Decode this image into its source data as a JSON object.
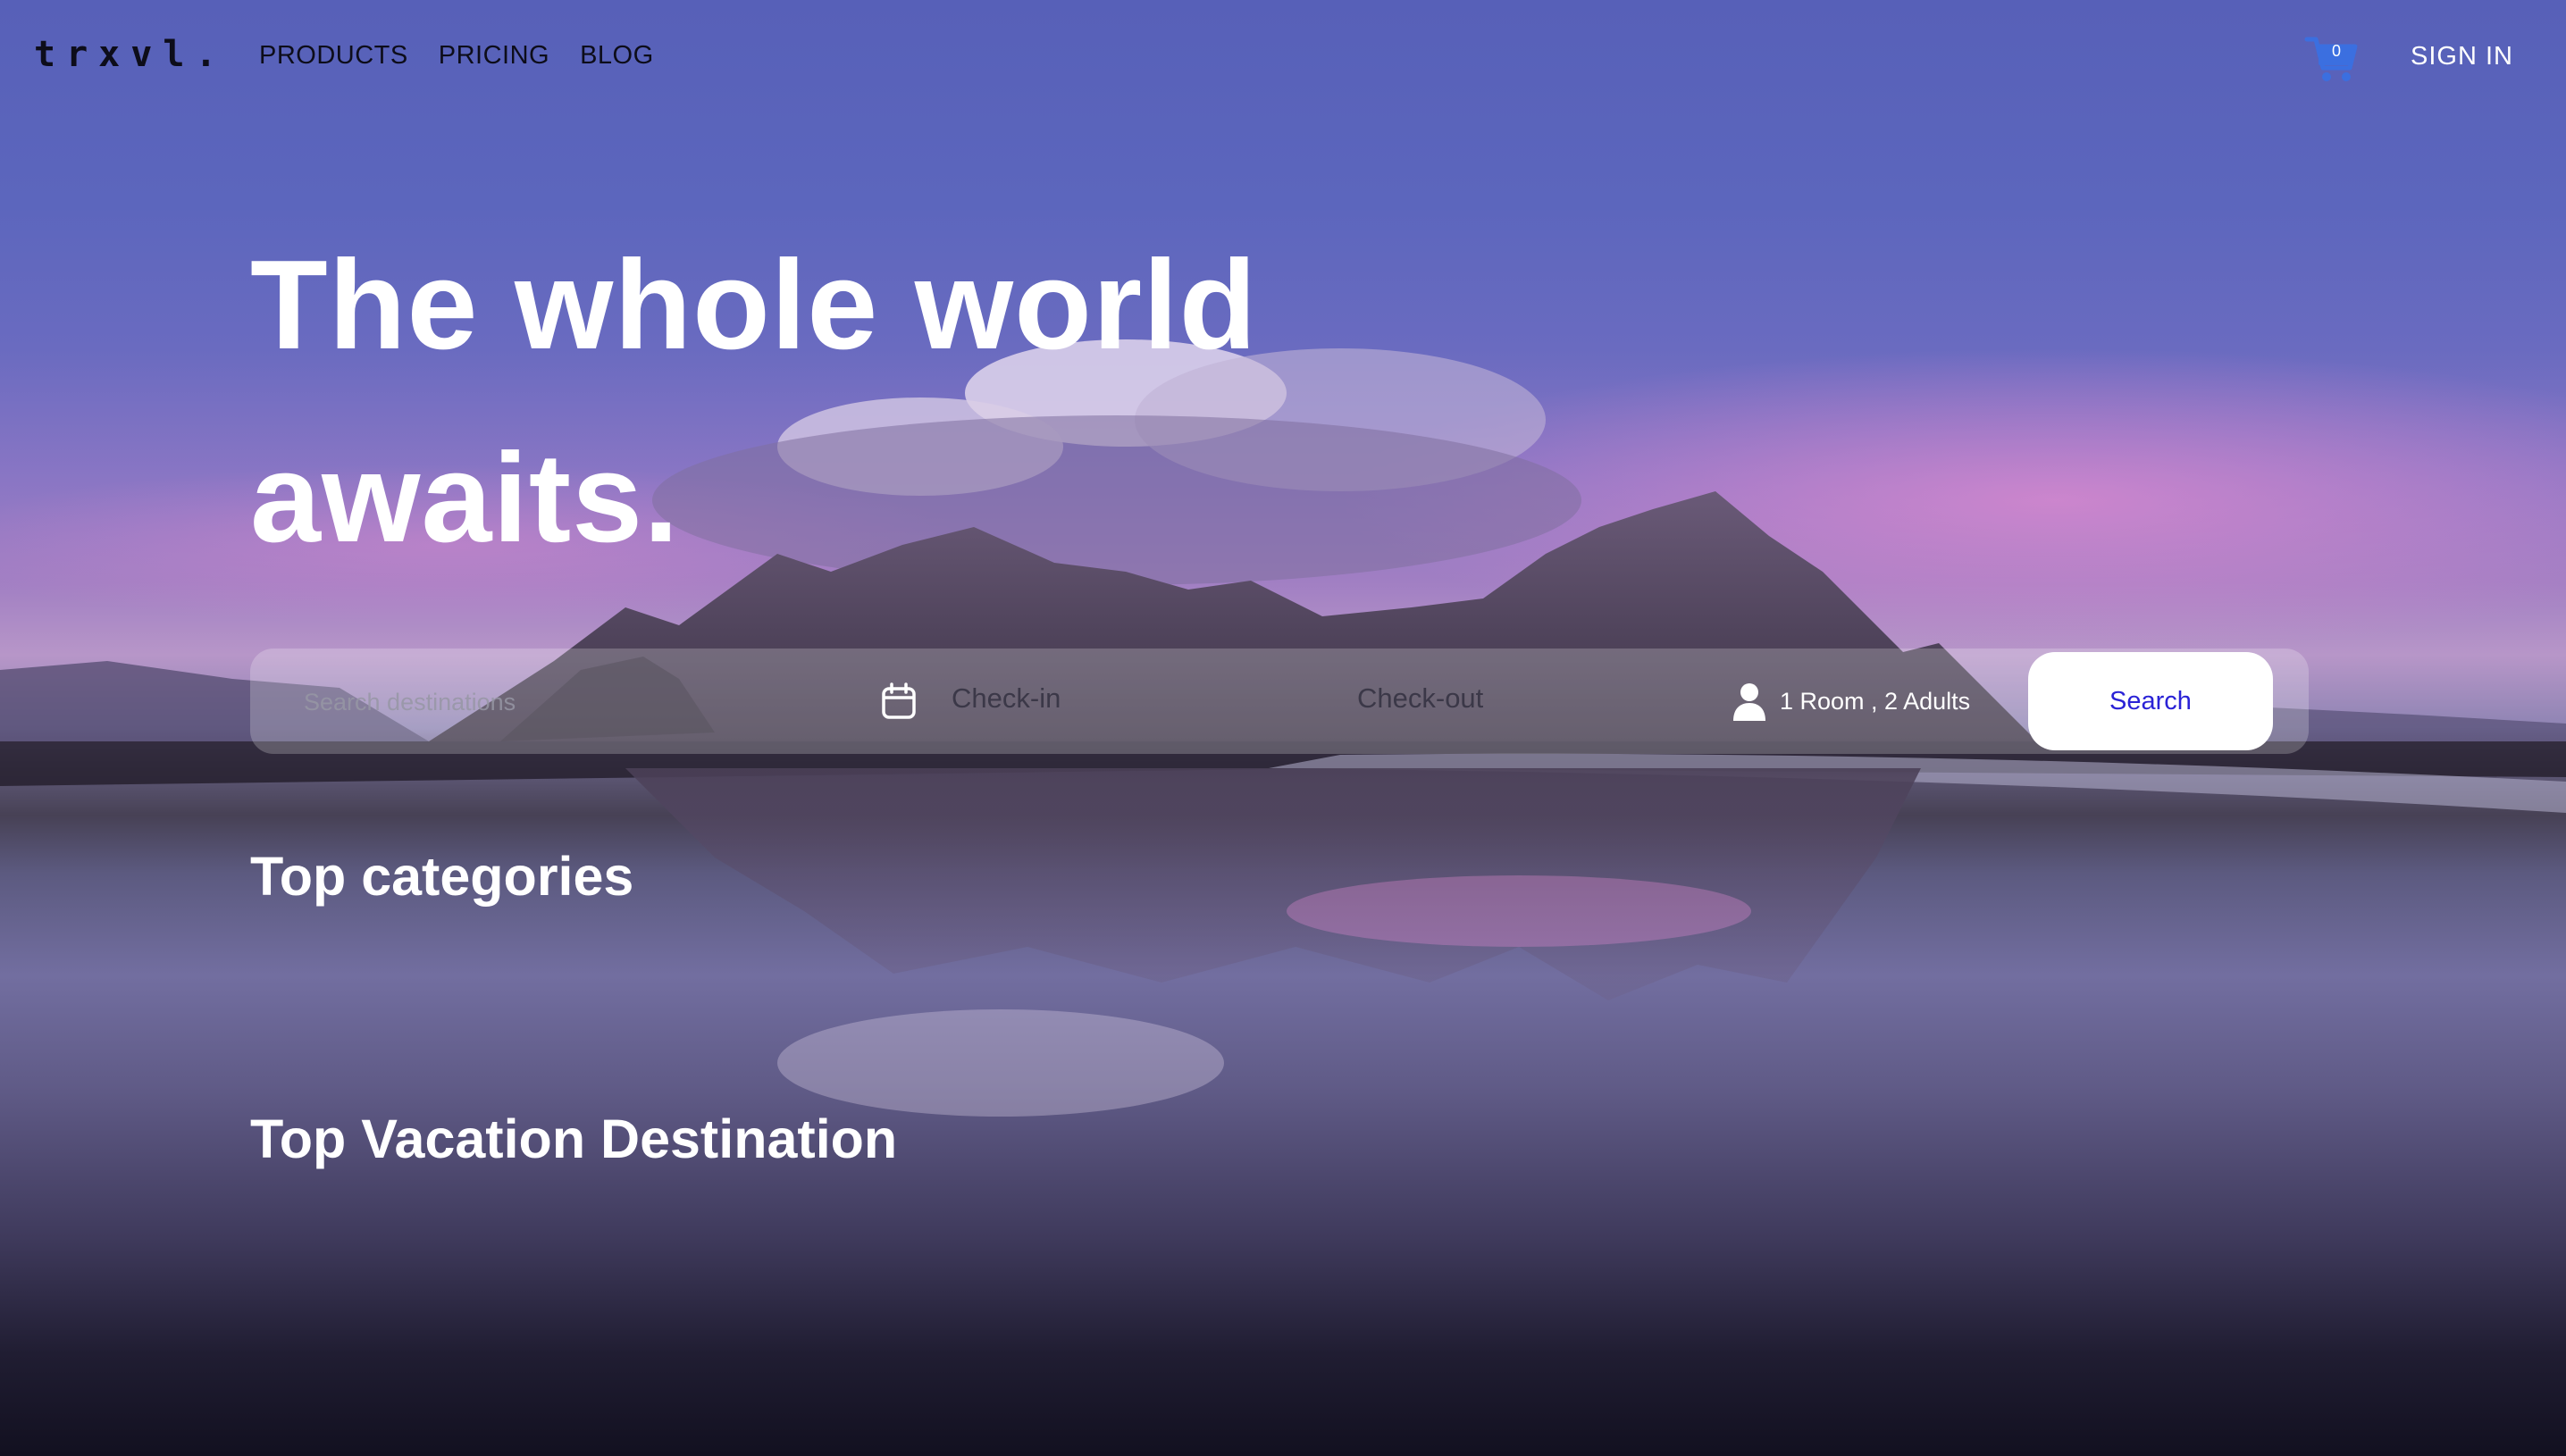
{
  "header": {
    "logo": "trxvl.",
    "nav": [
      "PRODUCTS",
      "PRICING",
      "BLOG"
    ],
    "cart_count": "0",
    "signin": "SIGN IN"
  },
  "hero": {
    "title_line1": "The whole world",
    "title_line2": "awaits."
  },
  "search": {
    "destination_placeholder": "Search destinations",
    "checkin": "Check-in",
    "checkout": "Check-out",
    "guests": "1 Room , 2 Adults",
    "button": "Search"
  },
  "sections": {
    "top_categories": "Top categories",
    "top_destinations": "Top Vacation Destination"
  },
  "colors": {
    "cart_icon": "#3b6fe0",
    "search_button_text": "#2a22d6",
    "nav_text": "#0d0d1a"
  },
  "icons": {
    "cart": "shopping-cart-icon",
    "calendar": "calendar-icon",
    "guests": "person-icon"
  }
}
